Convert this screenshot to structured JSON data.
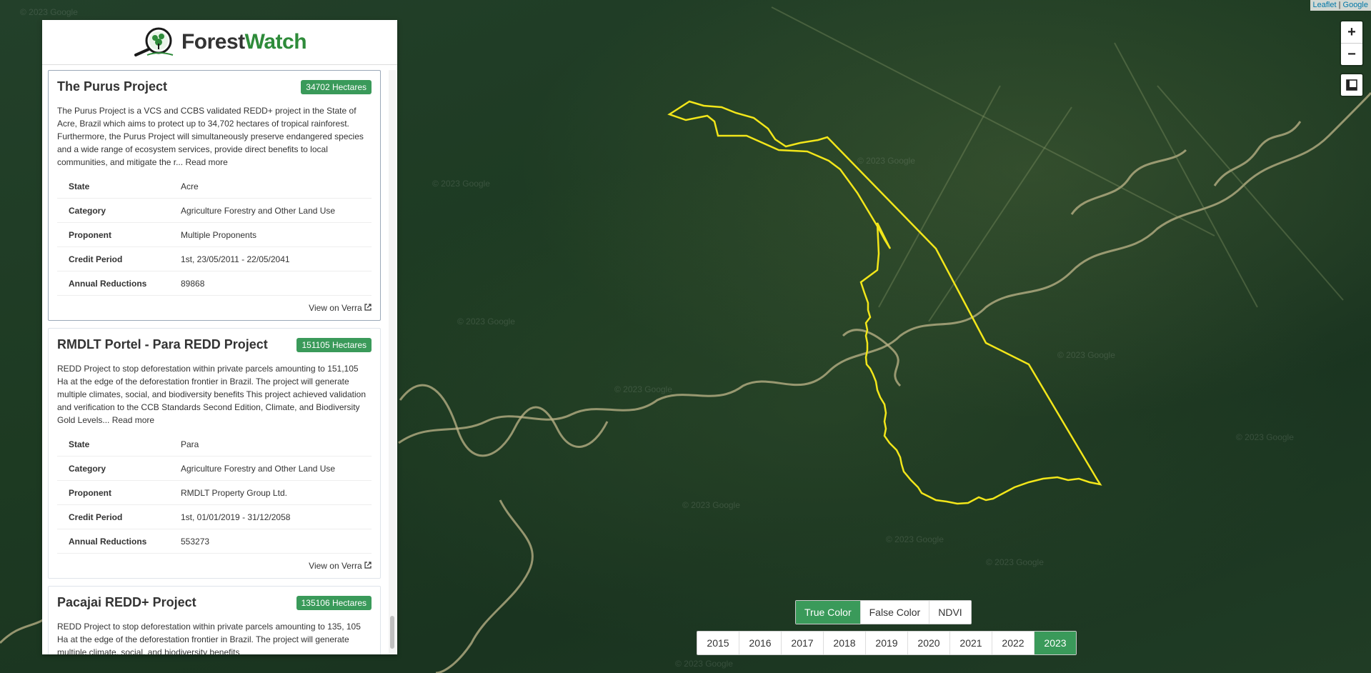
{
  "attribution": {
    "leaflet": "Leaflet",
    "sep": "|",
    "google": "Google"
  },
  "map": {
    "watermark": "© 2023 Google",
    "zoom_in": "+",
    "zoom_out": "−"
  },
  "logo": {
    "part1": "Forest",
    "part2": "Watch"
  },
  "projects": [
    {
      "title": "The Purus Project",
      "badge": "34702 Hectares",
      "description": "The Purus Project is a VCS and CCBS validated REDD+ project in the State of Acre, Brazil which aims to protect up to 34,702 hectares of tropical rainforest. Furthermore, the Purus Project will simultaneously preserve endangered species and a wide range of ecosystem services, provide direct benefits to local communities, and mitigate the r...",
      "read_more": "Read more",
      "rows": [
        {
          "label": "State",
          "value": "Acre"
        },
        {
          "label": "Category",
          "value": "Agriculture Forestry and Other Land Use"
        },
        {
          "label": "Proponent",
          "value": "Multiple Proponents"
        },
        {
          "label": "Credit Period",
          "value": "1st, 23/05/2011 - 22/05/2041"
        },
        {
          "label": "Annual Reductions",
          "value": "89868"
        }
      ],
      "link": "View on Verra"
    },
    {
      "title": "RMDLT Portel - Para REDD Project",
      "badge": "151105 Hectares",
      "description": "REDD Project to stop deforestation within private parcels amounting to 151,105 Ha at the edge of the deforestation frontier in Brazil. The project will generate multiple climates, social, and biodiversity benefits This project achieved validation and verification to the CCB Standards Second Edition, Climate, and Biodiversity Gold Levels...",
      "read_more": "Read more",
      "rows": [
        {
          "label": "State",
          "value": "Para"
        },
        {
          "label": "Category",
          "value": "Agriculture Forestry and Other Land Use"
        },
        {
          "label": "Proponent",
          "value": "RMDLT Property Group Ltd."
        },
        {
          "label": "Credit Period",
          "value": "1st, 01/01/2019 - 31/12/2058"
        },
        {
          "label": "Annual Reductions",
          "value": "553273"
        }
      ],
      "link": "View on Verra"
    },
    {
      "title": "Pacajai REDD+ Project",
      "badge": "135106 Hectares",
      "description": "REDD Project to stop deforestation within private parcels amounting to 135, 105 Ha at the edge of the deforestation frontier in Brazil. The project will generate multiple climate, social, and biodiversity benefits",
      "read_more": "",
      "rows": [],
      "link": ""
    }
  ],
  "color_modes": [
    {
      "label": "True Color",
      "active": true
    },
    {
      "label": "False Color",
      "active": false
    },
    {
      "label": "NDVI",
      "active": false
    }
  ],
  "years": [
    {
      "label": "2015",
      "active": false
    },
    {
      "label": "2016",
      "active": false
    },
    {
      "label": "2017",
      "active": false
    },
    {
      "label": "2018",
      "active": false
    },
    {
      "label": "2019",
      "active": false
    },
    {
      "label": "2020",
      "active": false
    },
    {
      "label": "2021",
      "active": false
    },
    {
      "label": "2022",
      "active": false
    },
    {
      "label": "2023",
      "active": true
    }
  ],
  "colors": {
    "accent": "#3a9a5a",
    "boundary": "#f2e61a",
    "river": "#c9bf8a"
  }
}
